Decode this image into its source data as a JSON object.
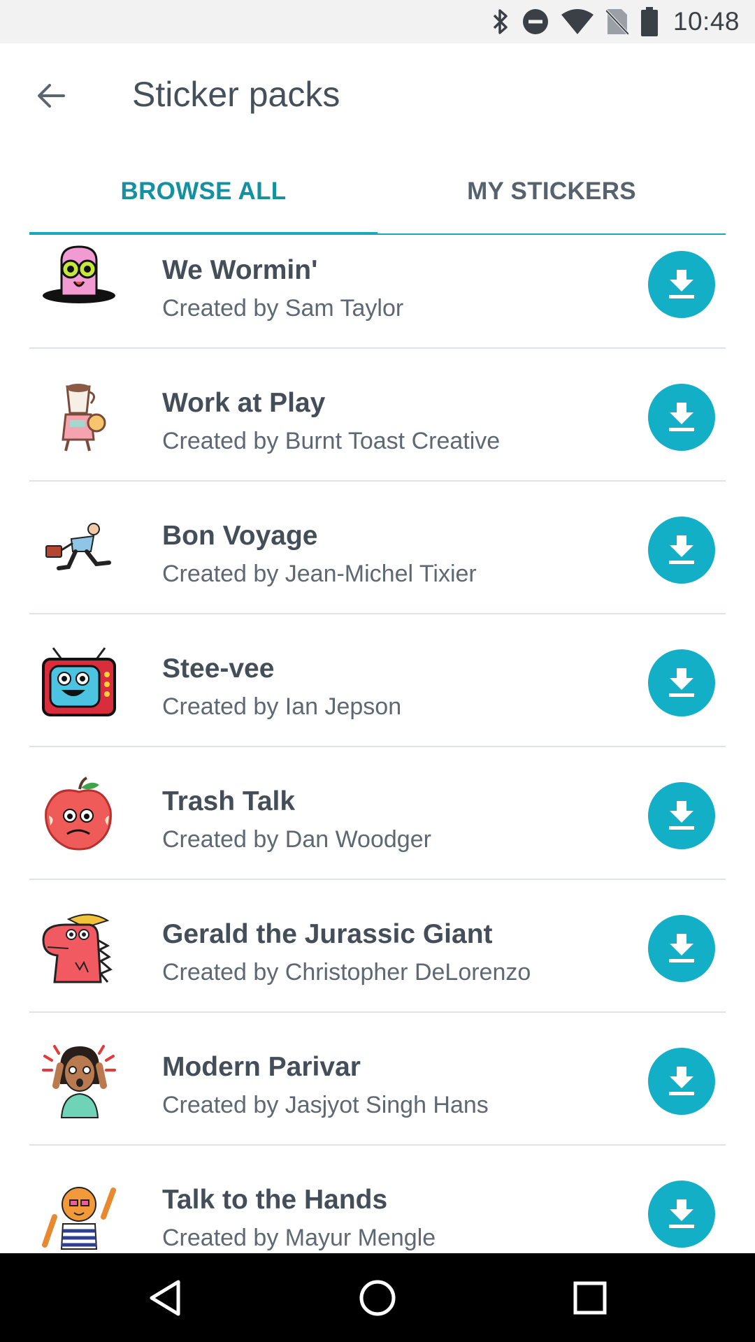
{
  "status_bar": {
    "time": "10:48",
    "icons": [
      "bluetooth-icon",
      "do-not-disturb-icon",
      "wifi-icon",
      "no-sim-icon",
      "battery-icon"
    ]
  },
  "app_bar": {
    "title": "Sticker packs",
    "back_icon": "arrow-back-icon"
  },
  "tabs": [
    {
      "label": "BROWSE ALL",
      "active": true
    },
    {
      "label": "MY STICKERS",
      "active": false
    }
  ],
  "colors": {
    "accent": "#1aa7b8",
    "download_button": "#12afc6",
    "title_text": "#44505a"
  },
  "packs": [
    {
      "name": "We Wormin'",
      "author": "Created by Sam Taylor",
      "thumb_icon": "worm-sticker-icon"
    },
    {
      "name": "Work at Play",
      "author": "Created by Burnt Toast Creative",
      "thumb_icon": "coffee-cup-character-sticker-icon"
    },
    {
      "name": "Bon Voyage",
      "author": "Created by Jean-Michel Tixier",
      "thumb_icon": "running-traveler-sticker-icon"
    },
    {
      "name": "Stee-vee",
      "author": "Created by Ian Jepson",
      "thumb_icon": "tv-character-sticker-icon"
    },
    {
      "name": "Trash Talk",
      "author": "Created by Dan Woodger",
      "thumb_icon": "apple-core-sticker-icon"
    },
    {
      "name": "Gerald the Jurassic Giant",
      "author": "Created by Christopher DeLorenzo",
      "thumb_icon": "dinosaur-sticker-icon"
    },
    {
      "name": "Modern Parivar",
      "author": "Created by Jasjyot Singh Hans",
      "thumb_icon": "surprised-woman-sticker-icon"
    },
    {
      "name": "Talk to the Hands",
      "author": "Created by Mayur Mengle",
      "thumb_icon": "rock-hands-sticker-icon"
    }
  ],
  "nav_bar": {
    "buttons": [
      "back-triangle-icon",
      "home-circle-icon",
      "recents-square-icon"
    ]
  }
}
